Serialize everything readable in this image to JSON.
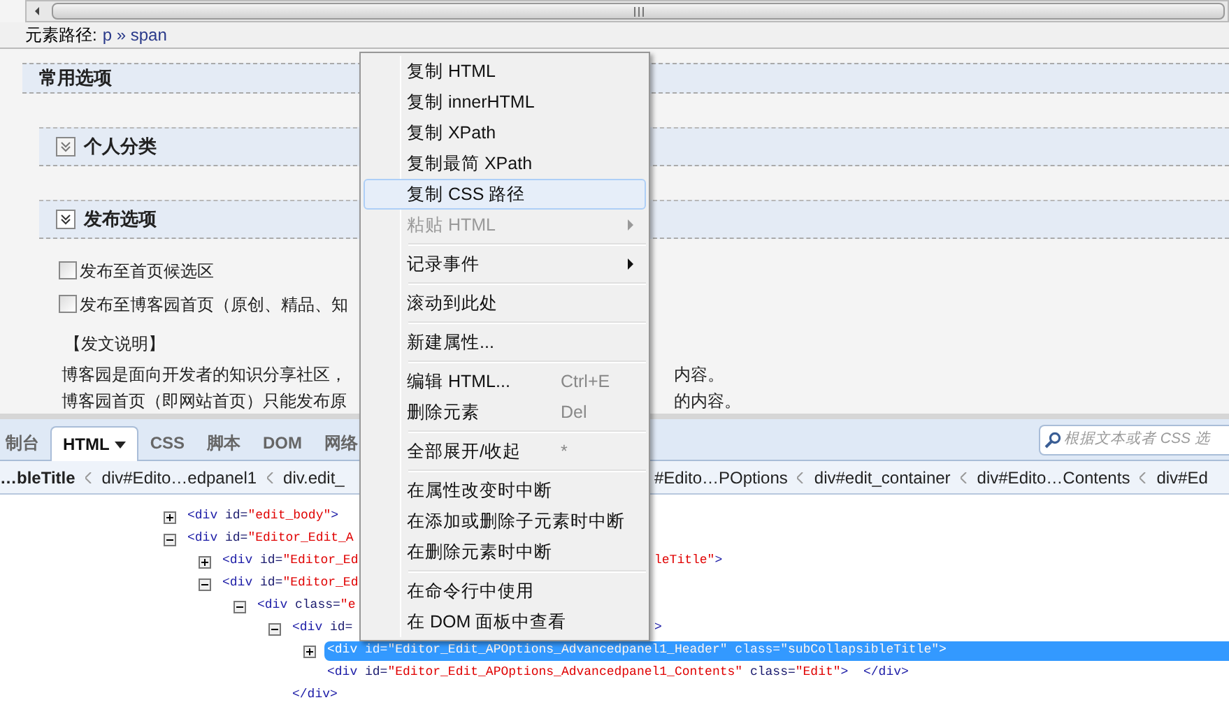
{
  "path_bar": {
    "label": "元素路径:",
    "value": "p » span"
  },
  "section": {
    "title": "常用选项"
  },
  "panels": [
    {
      "title": "个人分类",
      "expanded": false
    },
    {
      "title": "发布选项",
      "expanded": true
    }
  ],
  "options": [
    {
      "label": "发布至首页候选区",
      "checked": false
    },
    {
      "label": "发布至博客园首页（原创、精品、知",
      "checked": false
    }
  ],
  "notice": {
    "title": "【发文说明】",
    "lines": [
      {
        "left": "博客园是面向开发者的知识分享社区，",
        "right": "内容。"
      },
      {
        "left": "博客园首页（即网站首页）只能发布原",
        "right": "的内容。"
      }
    ]
  },
  "devtools": {
    "tabs": [
      {
        "label": "制台",
        "selected": false,
        "dropdown": false
      },
      {
        "label": "HTML",
        "selected": true,
        "dropdown": true
      },
      {
        "label": "CSS",
        "selected": false,
        "dropdown": false
      },
      {
        "label": "脚本",
        "selected": false,
        "dropdown": false
      },
      {
        "label": "DOM",
        "selected": false,
        "dropdown": false
      },
      {
        "label": "网络",
        "selected": false,
        "dropdown": false
      }
    ],
    "search": {
      "placeholder": "根据文本或者 CSS 选"
    },
    "breadcrumb": {
      "left": [
        "…bleTitle",
        "div#Edito…edpanel1",
        "div.edit_"
      ],
      "right": [
        "#Edito…POptions",
        "div#edit_container",
        "div#Edito…Contents",
        "div#Ed"
      ]
    },
    "tree": [
      {
        "expanded": false,
        "selected": false,
        "tokens": [
          {
            "kind": "tag",
            "text": "<div"
          },
          {
            "kind": "attr",
            "text": " id="
          },
          {
            "kind": "value",
            "text": "\"edit_body\""
          },
          {
            "kind": "tag",
            "text": ">"
          }
        ]
      },
      {
        "expanded": true,
        "selected": false,
        "tokens": [
          {
            "kind": "tag",
            "text": "<div"
          },
          {
            "kind": "attr",
            "text": " id="
          },
          {
            "kind": "value",
            "text": "\"Editor_Edit_A"
          }
        ],
        "children": [
          {
            "expanded": false,
            "selected": false,
            "tokens": [
              {
                "kind": "tag",
                "text": "<div"
              },
              {
                "kind": "attr",
                "text": " id="
              },
              {
                "kind": "value",
                "text": "\"Editor_Ed"
              }
            ],
            "right": [
              {
                "kind": "value",
                "text": "leTitle\""
              },
              {
                "kind": "tag",
                "text": ">"
              }
            ]
          },
          {
            "expanded": true,
            "selected": false,
            "tokens": [
              {
                "kind": "tag",
                "text": "<div"
              },
              {
                "kind": "attr",
                "text": " id="
              },
              {
                "kind": "value",
                "text": "\"Editor_Ed"
              }
            ],
            "children": [
              {
                "expanded": true,
                "selected": false,
                "tokens": [
                  {
                    "kind": "tag",
                    "text": "<div"
                  },
                  {
                    "kind": "attr",
                    "text": " class="
                  },
                  {
                    "kind": "value",
                    "text": "\"e"
                  }
                ],
                "children": [
                  {
                    "expanded": true,
                    "selected": false,
                    "tokens": [
                      {
                        "kind": "tag",
                        "text": "<div"
                      },
                      {
                        "kind": "attr",
                        "text": " id="
                      }
                    ],
                    "right": [
                      {
                        "kind": "tag",
                        "text": ">"
                      }
                    ],
                    "children": [
                      {
                        "expanded": false,
                        "selected": true,
                        "tokens": [
                          {
                            "kind": "tag",
                            "text": "<div"
                          },
                          {
                            "kind": "attr",
                            "text": " id="
                          },
                          {
                            "kind": "value",
                            "text": "\"Editor_Edit_APOptions_Advancedpanel1_Header\""
                          },
                          {
                            "kind": "attr",
                            "text": " class="
                          },
                          {
                            "kind": "value",
                            "text": "\"subCollapsibleTitle\""
                          },
                          {
                            "kind": "tag",
                            "text": ">"
                          }
                        ]
                      },
                      {
                        "selected": false,
                        "tokens": [
                          {
                            "kind": "tag",
                            "text": "<div"
                          },
                          {
                            "kind": "attr",
                            "text": " id="
                          },
                          {
                            "kind": "value",
                            "text": "\"Editor_Edit_APOptions_Advancedpanel1_Contents\""
                          },
                          {
                            "kind": "attr",
                            "text": " class="
                          },
                          {
                            "kind": "value",
                            "text": "\"Edit\""
                          },
                          {
                            "kind": "tag",
                            "text": ">"
                          },
                          {
                            "kind": "tag",
                            "text": "  </div>"
                          }
                        ]
                      }
                    ]
                  },
                  {
                    "selected": false,
                    "tokens": [
                      {
                        "kind": "tag",
                        "text": "</div>"
                      }
                    ]
                  }
                ]
              }
            ]
          }
        ]
      }
    ]
  },
  "context_menu": [
    {
      "kind": "item",
      "label": "复制 HTML",
      "disabled": false,
      "selected": false
    },
    {
      "kind": "item",
      "label": "复制 innerHTML",
      "disabled": false,
      "selected": false
    },
    {
      "kind": "item",
      "label": "复制 XPath",
      "disabled": false,
      "selected": false
    },
    {
      "kind": "item",
      "label": "复制最简 XPath",
      "disabled": false,
      "selected": false
    },
    {
      "kind": "item",
      "label": "复制 CSS 路径",
      "disabled": false,
      "selected": true
    },
    {
      "kind": "item",
      "label": "粘贴 HTML",
      "disabled": true,
      "selected": false,
      "submenu": true
    },
    {
      "kind": "separator"
    },
    {
      "kind": "item",
      "label": "记录事件",
      "disabled": false,
      "selected": false,
      "submenu": true
    },
    {
      "kind": "separator"
    },
    {
      "kind": "item",
      "label": "滚动到此处",
      "disabled": false,
      "selected": false
    },
    {
      "kind": "separator"
    },
    {
      "kind": "item",
      "label": "新建属性...",
      "disabled": false,
      "selected": false
    },
    {
      "kind": "separator"
    },
    {
      "kind": "item",
      "label": "编辑 HTML...",
      "disabled": false,
      "selected": false,
      "shortcut": "Ctrl+E"
    },
    {
      "kind": "item",
      "label": "删除元素",
      "disabled": false,
      "selected": false,
      "shortcut": "Del"
    },
    {
      "kind": "separator"
    },
    {
      "kind": "item",
      "label": "全部展开/收起",
      "disabled": false,
      "selected": false,
      "shortcut": "*"
    },
    {
      "kind": "separator"
    },
    {
      "kind": "item",
      "label": "在属性改变时中断",
      "disabled": false,
      "selected": false
    },
    {
      "kind": "item",
      "label": "在添加或删除子元素时中断",
      "disabled": false,
      "selected": false
    },
    {
      "kind": "item",
      "label": "在删除元素时中断",
      "disabled": false,
      "selected": false
    },
    {
      "kind": "separator"
    },
    {
      "kind": "item",
      "label": "在命令行中使用",
      "disabled": false,
      "selected": false
    },
    {
      "kind": "item",
      "label": "在 DOM 面板中查看",
      "disabled": false,
      "selected": false
    }
  ]
}
